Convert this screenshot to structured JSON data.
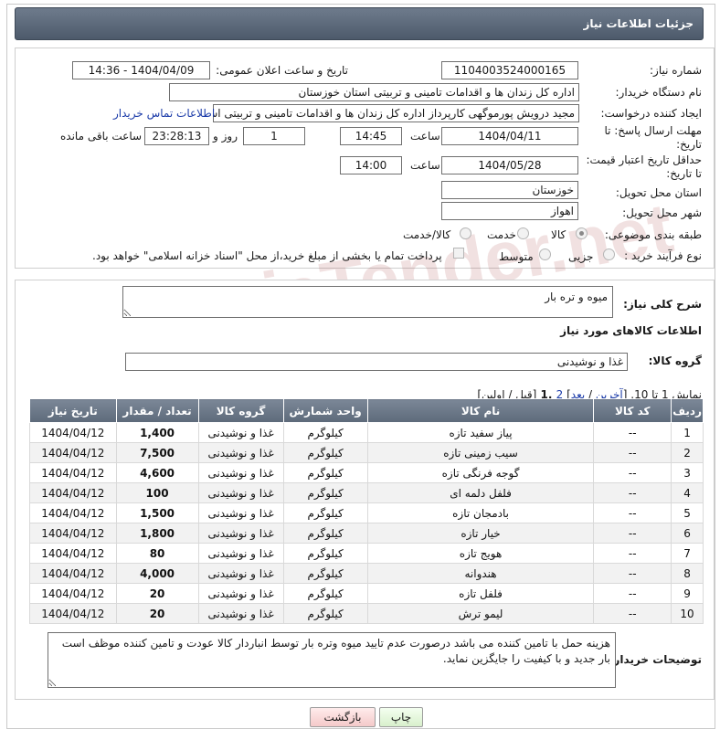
{
  "header": {
    "title": "جزئیات اطلاعات نیاز"
  },
  "form": {
    "need_number_label": "شماره نیاز:",
    "need_number": "1104003524000165",
    "announce_datetime_label": "تاریخ و ساعت اعلان عمومی:",
    "announce_datetime": "1404/04/09 - 14:36",
    "buyer_org_label": "نام دستگاه خریدار:",
    "buyer_org": "اداره کل زندان ها و اقدامات تامینی و تربیتی استان خوزستان",
    "requester_label": "ایجاد کننده درخواست:",
    "requester": "مجید درویش پورموگهی کارپرداز اداره کل زندان ها و اقدامات تامینی و تربیتی است",
    "buyer_contact_link": "اطلاعات تماس خریدار",
    "reply_deadline_label": "مهلت ارسال پاسخ: تا تاریخ:",
    "reply_date": "1404/04/11",
    "time_label": "ساعت",
    "reply_time": "14:45",
    "days_value": "1",
    "days_label": "روز و",
    "remaining_time": "23:28:13",
    "remaining_label": "ساعت باقی مانده",
    "price_validity_label": "حداقل تاریخ اعتبار قیمت: تا تاریخ:",
    "price_date": "1404/05/28",
    "price_time": "14:00",
    "delivery_province_label": "استان محل تحویل:",
    "delivery_province": "خوزستان",
    "delivery_city_label": "شهر محل تحویل:",
    "delivery_city": "اهواز",
    "category_label": "طبقه بندی موضوعی:",
    "category_options": [
      "کالا",
      "خدمت",
      "کالا/خدمت"
    ],
    "process_label": "نوع فرآیند خرید :",
    "process_options": [
      "جزیی",
      "متوسط"
    ],
    "payment_note": "پرداخت تمام یا بخشی از مبلغ خرید،از محل \"اسناد خزانه اسلامی\" خواهد بود."
  },
  "details": {
    "general_desc_label": "شرح کلی نیاز:",
    "general_desc": "میوه و تره بار",
    "goods_info_title": "اطلاعات کالاهای مورد نیاز",
    "goods_group_label": "گروه کالا:",
    "goods_group": "غذا و نوشیدنی",
    "pagination_prefix": "نمایش 1 تا 10. [",
    "pagination_last": "آخرین",
    "pagination_sep": " / ",
    "pagination_next": "بعد",
    "pagination_mid": "] ",
    "pagination_page2": "2",
    "pagination_page1": " ,1 ",
    "pagination_suffix": "[قبل / اولین]",
    "table": {
      "headers": [
        "ردیف",
        "کد کالا",
        "نام کالا",
        "واحد شمارش",
        "گروه کالا",
        "تعداد / مقدار",
        "تاریخ نیاز"
      ],
      "rows": [
        [
          "1",
          "--",
          "پیاز سفید تازه",
          "کیلوگرم",
          "غذا و نوشیدنی",
          "1,400",
          "1404/04/12"
        ],
        [
          "2",
          "--",
          "سیب زمینی تازه",
          "کیلوگرم",
          "غذا و نوشیدنی",
          "7,500",
          "1404/04/12"
        ],
        [
          "3",
          "--",
          "گوجه فرنگی تازه",
          "کیلوگرم",
          "غذا و نوشیدنی",
          "4,600",
          "1404/04/12"
        ],
        [
          "4",
          "--",
          "فلفل دلمه ای",
          "کیلوگرم",
          "غذا و نوشیدنی",
          "100",
          "1404/04/12"
        ],
        [
          "5",
          "--",
          "بادمجان تازه",
          "کیلوگرم",
          "غذا و نوشیدنی",
          "1,500",
          "1404/04/12"
        ],
        [
          "6",
          "--",
          "خیار تازه",
          "کیلوگرم",
          "غذا و نوشیدنی",
          "1,800",
          "1404/04/12"
        ],
        [
          "7",
          "--",
          "هویج تازه",
          "کیلوگرم",
          "غذا و نوشیدنی",
          "80",
          "1404/04/12"
        ],
        [
          "8",
          "--",
          "هندوانه",
          "کیلوگرم",
          "غذا و نوشیدنی",
          "4,000",
          "1404/04/12"
        ],
        [
          "9",
          "--",
          "فلفل تازه",
          "کیلوگرم",
          "غذا و نوشیدنی",
          "20",
          "1404/04/12"
        ],
        [
          "10",
          "--",
          "لیمو ترش",
          "کیلوگرم",
          "غذا و نوشیدنی",
          "20",
          "1404/04/12"
        ]
      ]
    },
    "buyer_notes_label": "توضیحات خریدار:",
    "buyer_notes": "هزینه حمل با تامین کننده می باشد درصورت عدم تایید میوه وتره بار توسط انباردار کالا عودت و تامین کننده موظف است بار جدید و با کیفیت را جایگزین نماید."
  },
  "buttons": {
    "print": "چاپ",
    "back": "بازگشت"
  },
  "watermark": {
    "text": "AriaTender.net"
  }
}
